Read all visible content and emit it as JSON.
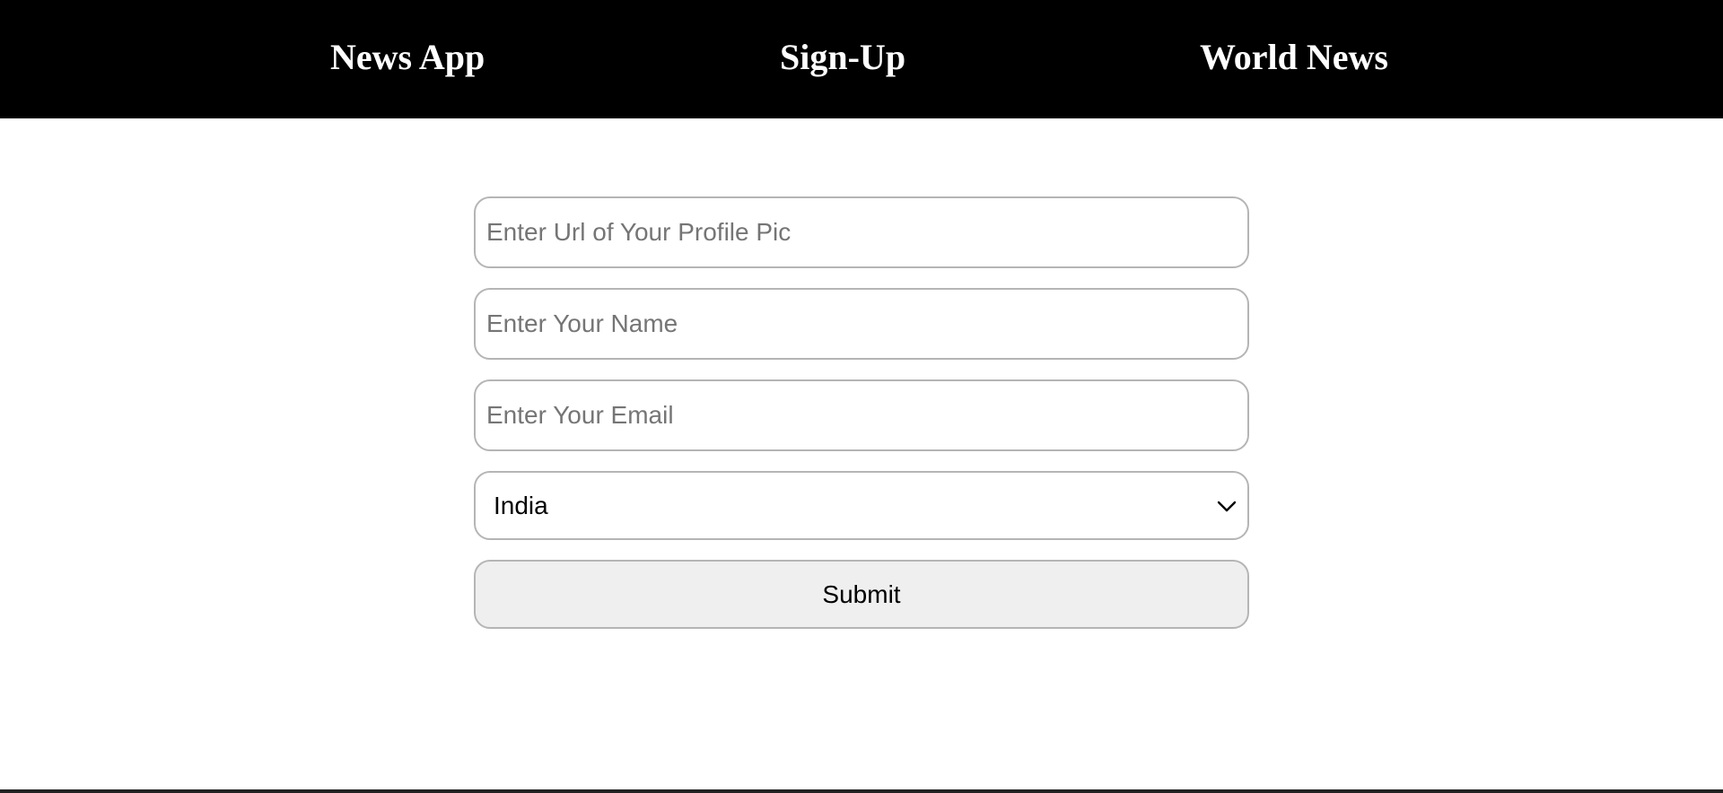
{
  "nav": {
    "brand": "News App",
    "signup": "Sign-Up",
    "world_news": "World News"
  },
  "form": {
    "profile_pic": {
      "placeholder": "Enter Url of Your Profile Pic",
      "value": ""
    },
    "name": {
      "placeholder": "Enter Your Name",
      "value": ""
    },
    "email": {
      "placeholder": "Enter Your Email",
      "value": ""
    },
    "country": {
      "selected": "India"
    },
    "submit_label": "Submit"
  },
  "colors": {
    "navbar_bg": "#000000",
    "nav_text": "#ffffff",
    "border": "#b5b5b5",
    "button_bg": "#efefef"
  },
  "icons": {
    "select_arrow": "chevron-down-icon"
  }
}
